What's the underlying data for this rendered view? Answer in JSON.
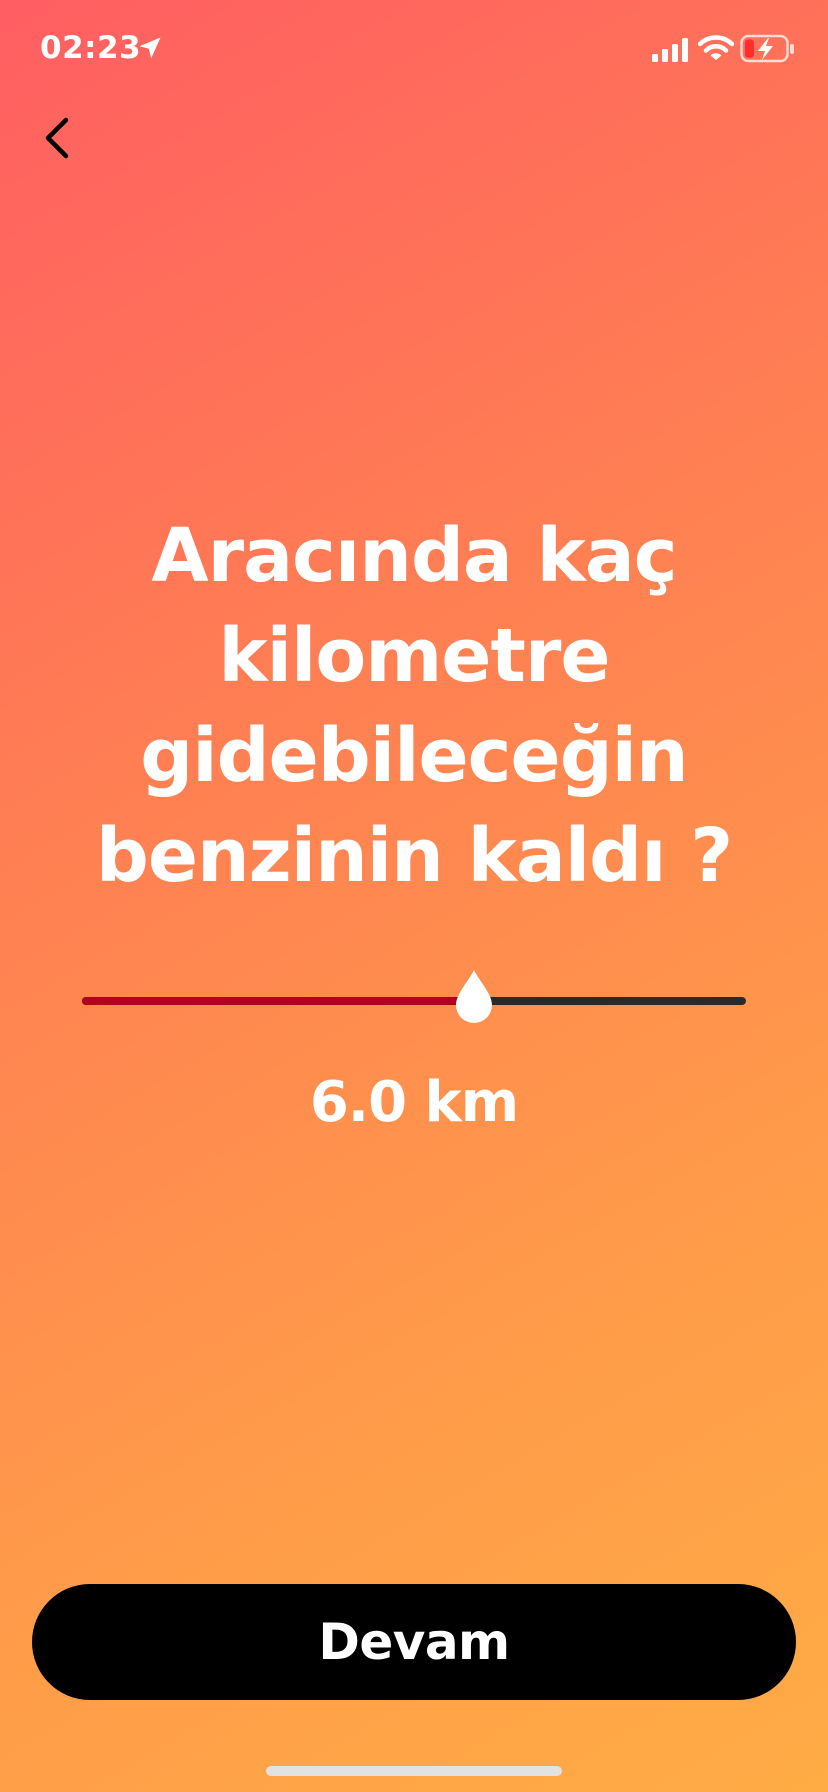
{
  "status_bar": {
    "time": "02:23",
    "icons": [
      "location-arrow-icon",
      "cellular-signal-icon",
      "wifi-icon",
      "battery-charging-icon"
    ],
    "battery_level_fraction": 0.2
  },
  "navigation": {
    "back_icon": "chevron-left-icon"
  },
  "question": {
    "line1": "Aracında kaç",
    "line2": "kilometre",
    "line3": "gidebileceğin",
    "line4": "benzinin kaldı ?"
  },
  "slider": {
    "value_label": "6.0 km",
    "value_fraction": 0.59,
    "fill_color": "#b3001b",
    "track_color": "#2a2a2a",
    "thumb_icon": "drop-icon"
  },
  "actions": {
    "continue_label": "Devam"
  },
  "colors": {
    "background_gradient": [
      "#ff5e62",
      "#ffac45"
    ],
    "text": "#ffffff",
    "button": "#000000"
  }
}
